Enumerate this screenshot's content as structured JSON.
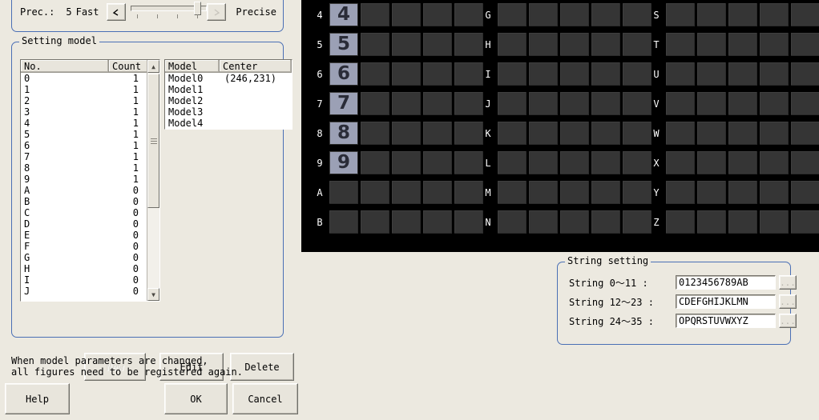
{
  "precision": {
    "label": "Prec.:",
    "value": "5",
    "fast_label": "Fast",
    "precise_label": "Precise",
    "left_arrow_icon": "left-arrow-icon",
    "right_arrow_icon": "right-arrow-icon",
    "slider_position_pct": 83
  },
  "setting_model": {
    "title": "Setting model",
    "no_count_list": {
      "columns": [
        "No.",
        "Count"
      ],
      "rows": [
        {
          "no": "0",
          "count": "1"
        },
        {
          "no": "1",
          "count": "1"
        },
        {
          "no": "2",
          "count": "1"
        },
        {
          "no": "3",
          "count": "1"
        },
        {
          "no": "4",
          "count": "1"
        },
        {
          "no": "5",
          "count": "1"
        },
        {
          "no": "6",
          "count": "1"
        },
        {
          "no": "7",
          "count": "1"
        },
        {
          "no": "8",
          "count": "1"
        },
        {
          "no": "9",
          "count": "1"
        },
        {
          "no": "A",
          "count": "0"
        },
        {
          "no": "B",
          "count": "0"
        },
        {
          "no": "C",
          "count": "0"
        },
        {
          "no": "D",
          "count": "0"
        },
        {
          "no": "E",
          "count": "0"
        },
        {
          "no": "F",
          "count": "0"
        },
        {
          "no": "G",
          "count": "0"
        },
        {
          "no": "H",
          "count": "0"
        },
        {
          "no": "I",
          "count": "0"
        },
        {
          "no": "J",
          "count": "0"
        }
      ]
    },
    "model_center_list": {
      "columns": [
        "Model",
        "Center"
      ],
      "rows": [
        {
          "model": "Model0",
          "center": "(246,231)"
        },
        {
          "model": "Model1",
          "center": ""
        },
        {
          "model": "Model2",
          "center": ""
        },
        {
          "model": "Model3",
          "center": ""
        },
        {
          "model": "Model4",
          "center": ""
        }
      ]
    },
    "buttons": {
      "new": "New",
      "edit": "Edit",
      "delete": "Delete"
    }
  },
  "note": "When model parameters are changed,\nall figures need to be registered again.",
  "dialog_buttons": {
    "help": "Help",
    "ok": "OK",
    "cancel": "Cancel"
  },
  "model_grid": {
    "columns": [
      {
        "rows": [
          {
            "label": "4",
            "cells": [
              "4",
              "",
              "",
              "",
              ""
            ]
          },
          {
            "label": "5",
            "cells": [
              "5",
              "",
              "",
              "",
              ""
            ]
          },
          {
            "label": "6",
            "cells": [
              "6",
              "",
              "",
              "",
              ""
            ]
          },
          {
            "label": "7",
            "cells": [
              "7",
              "",
              "",
              "",
              ""
            ]
          },
          {
            "label": "8",
            "cells": [
              "8",
              "",
              "",
              "",
              ""
            ]
          },
          {
            "label": "9",
            "cells": [
              "9",
              "",
              "",
              "",
              ""
            ]
          },
          {
            "label": "A",
            "cells": [
              "",
              "",
              "",
              "",
              ""
            ]
          },
          {
            "label": "B",
            "cells": [
              "",
              "",
              "",
              "",
              ""
            ]
          }
        ]
      },
      {
        "rows": [
          {
            "label": "G",
            "cells": [
              "",
              "",
              "",
              "",
              ""
            ]
          },
          {
            "label": "H",
            "cells": [
              "",
              "",
              "",
              "",
              ""
            ]
          },
          {
            "label": "I",
            "cells": [
              "",
              "",
              "",
              "",
              ""
            ]
          },
          {
            "label": "J",
            "cells": [
              "",
              "",
              "",
              "",
              ""
            ]
          },
          {
            "label": "K",
            "cells": [
              "",
              "",
              "",
              "",
              ""
            ]
          },
          {
            "label": "L",
            "cells": [
              "",
              "",
              "",
              "",
              ""
            ]
          },
          {
            "label": "M",
            "cells": [
              "",
              "",
              "",
              "",
              ""
            ]
          },
          {
            "label": "N",
            "cells": [
              "",
              "",
              "",
              "",
              ""
            ]
          }
        ]
      },
      {
        "rows": [
          {
            "label": "S",
            "cells": [
              "",
              "",
              "",
              "",
              ""
            ]
          },
          {
            "label": "T",
            "cells": [
              "",
              "",
              "",
              "",
              ""
            ]
          },
          {
            "label": "U",
            "cells": [
              "",
              "",
              "",
              "",
              ""
            ]
          },
          {
            "label": "V",
            "cells": [
              "",
              "",
              "",
              "",
              ""
            ]
          },
          {
            "label": "W",
            "cells": [
              "",
              "",
              "",
              "",
              ""
            ]
          },
          {
            "label": "X",
            "cells": [
              "",
              "",
              "",
              "",
              ""
            ]
          },
          {
            "label": "Y",
            "cells": [
              "",
              "",
              "",
              "",
              ""
            ]
          },
          {
            "label": "Z",
            "cells": [
              "",
              "",
              "",
              "",
              ""
            ]
          }
        ]
      }
    ]
  },
  "string_setting": {
    "title": "String setting",
    "rows": [
      {
        "label": "String  0～11 :",
        "value": "0123456789AB",
        "browse": "..."
      },
      {
        "label": "String 12～23 :",
        "value": "CDEFGHIJKLMN",
        "browse": "..."
      },
      {
        "label": "String 24～35 :",
        "value": "OPQRSTUVWXYZ",
        "browse": "..."
      }
    ]
  },
  "colors": {
    "window_bg": "#ece9e0",
    "group_border": "#4a6fb5",
    "grid_bg": "#000000",
    "grid_cell": "#353535",
    "model_thumb_bg": "#9ba0b5"
  }
}
